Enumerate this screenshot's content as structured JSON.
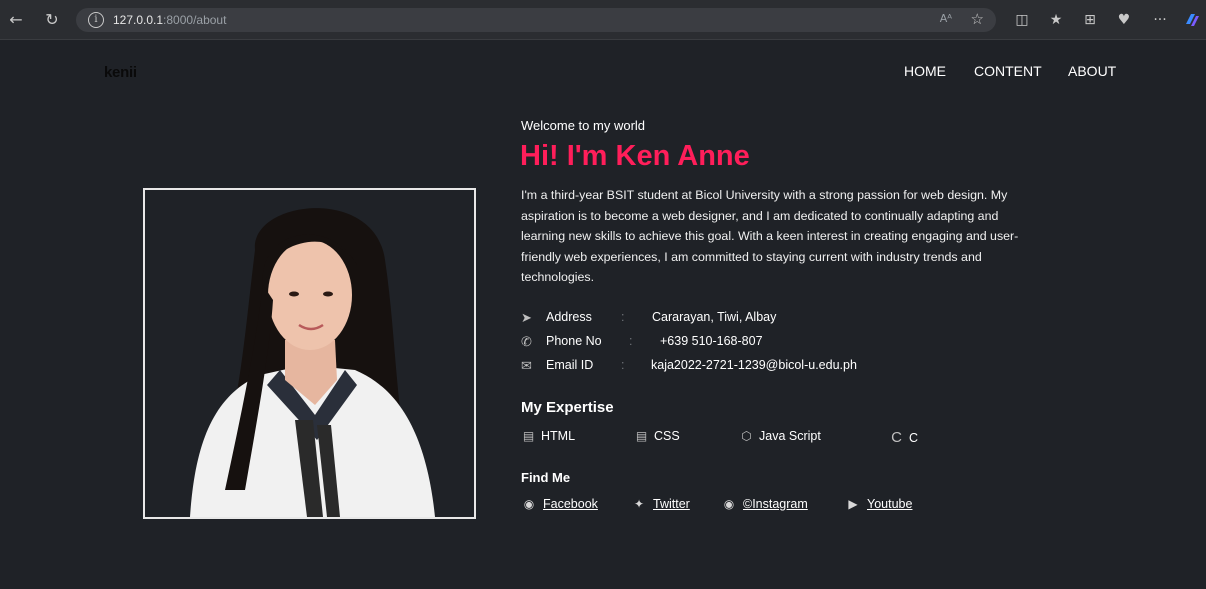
{
  "browser": {
    "url_host": "127.0.0.1",
    "url_path": ":8000/about",
    "read_aloud": "Aᴬ",
    "icons": [
      "back-icon",
      "refresh-icon",
      "info-icon",
      "read-aloud-icon",
      "favorite-star-icon",
      "split-screen-icon",
      "favorites-icon",
      "collections-icon",
      "extensions-icon",
      "more-icon",
      "copilot-icon"
    ],
    "more": "···"
  },
  "site": {
    "logo": "kenii",
    "nav": {
      "home": "HOME",
      "content": "CONTENT",
      "about": "ABOUT"
    }
  },
  "hero": {
    "welcome": "Welcome to my world",
    "headline": "Hi! I'm Ken Anne",
    "accent_color": "#ff1e5a",
    "bio": "I'm a third-year BSIT student at Bicol University with a strong passion for web design. My aspiration is to become a web designer, and I am dedicated to continually adapting and learning new skills to achieve this goal. With a keen interest in creating engaging and user-friendly web experiences, I am committed to staying current with industry trends and technologies."
  },
  "contact": {
    "address": {
      "icon": "paper-plane-icon",
      "label": "Address",
      "sep": ":",
      "value": "Cararayan, Tiwi, Albay"
    },
    "phone": {
      "icon": "phone-icon",
      "label": "Phone No",
      "sep": ":",
      "value": "+639 510-168-807"
    },
    "email": {
      "icon": "envelope-icon",
      "label": "Email ID",
      "sep": ":",
      "value": "kaja2022-2721-1239@bicol-u.edu.ph"
    }
  },
  "expertise": {
    "title": "My Expertise",
    "items": [
      {
        "icon": "html5-icon",
        "label": "HTML"
      },
      {
        "icon": "css3-icon",
        "label": "CSS"
      },
      {
        "icon": "nodejs-icon",
        "label": "Java Script"
      },
      {
        "icon": "c-letter-icon",
        "label": "C"
      }
    ]
  },
  "find_me": {
    "title": "Find Me",
    "links": [
      {
        "icon": "facebook-icon",
        "label": "Facebook"
      },
      {
        "icon": "twitter-icon",
        "label": "Twitter"
      },
      {
        "icon": "instagram-icon",
        "label": "©Instagram"
      },
      {
        "icon": "youtube-icon",
        "label": "Youtube"
      }
    ]
  }
}
